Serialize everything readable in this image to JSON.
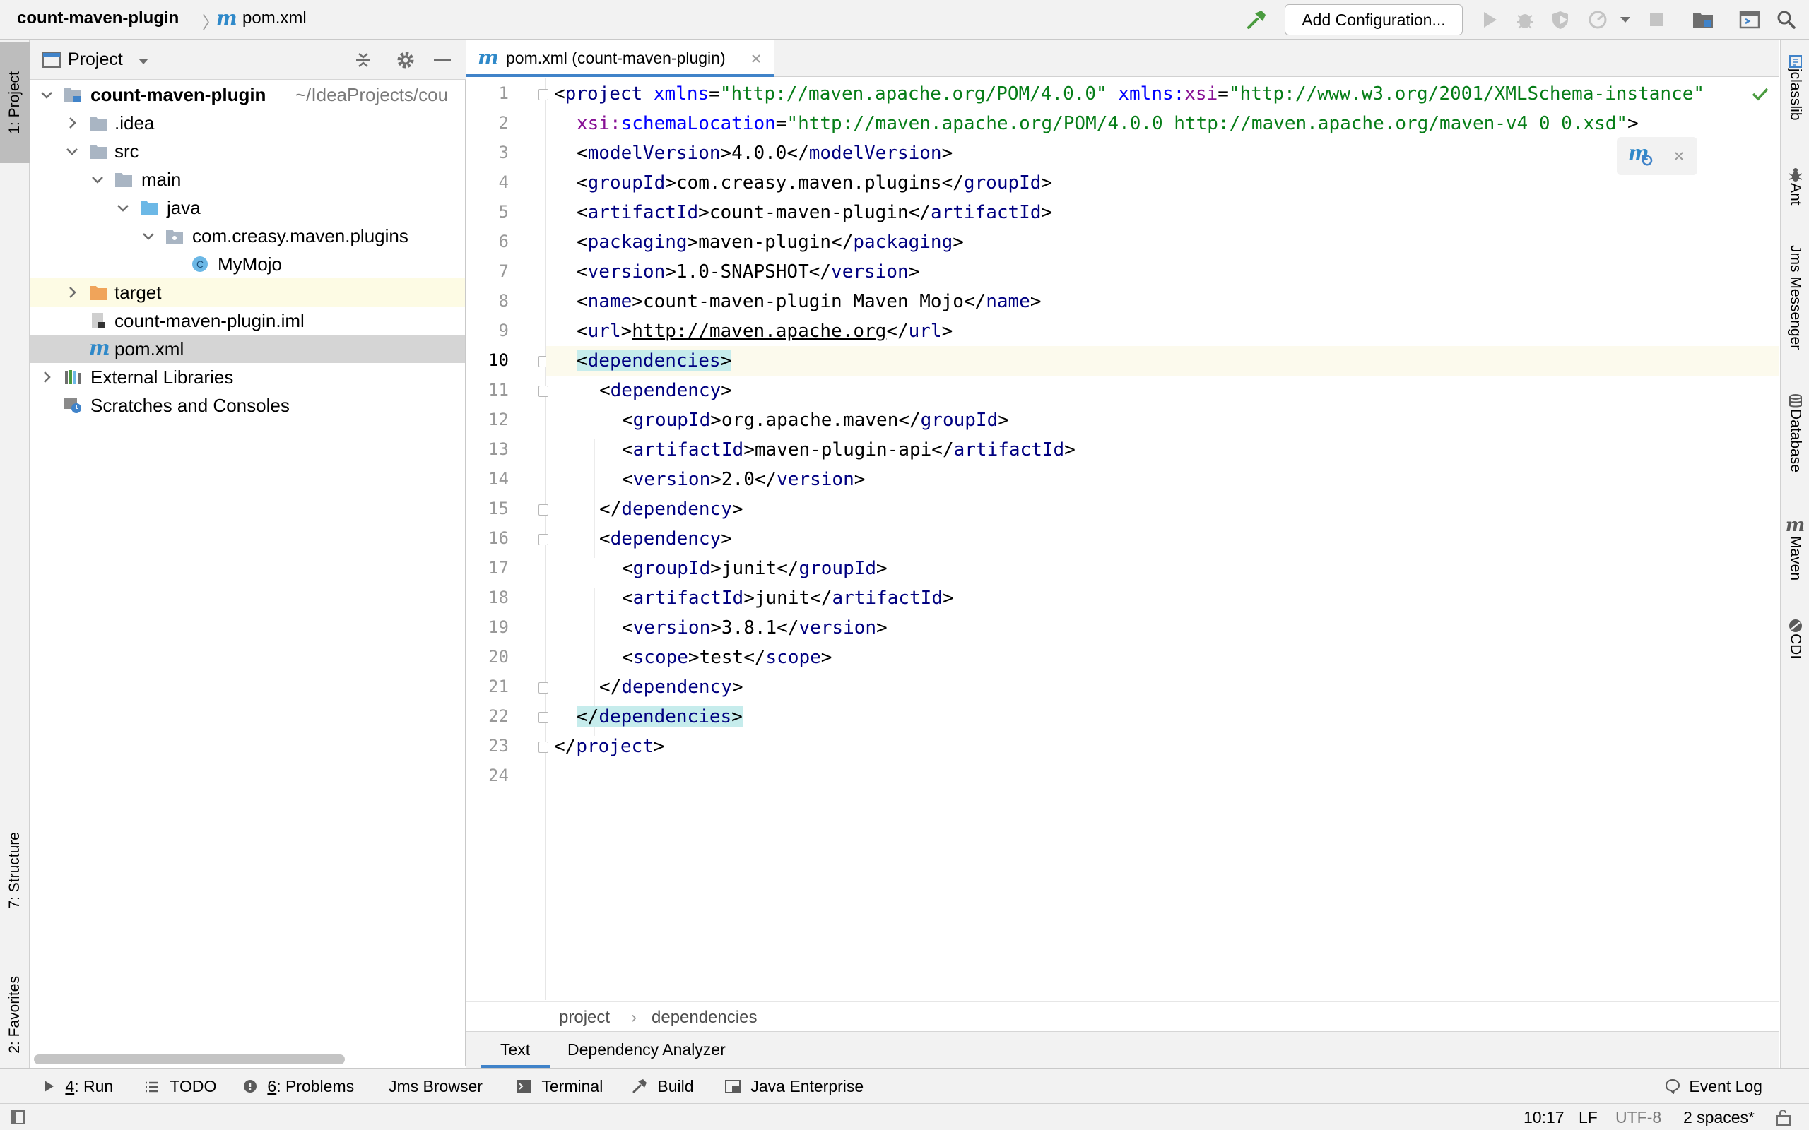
{
  "navbar": {
    "project_name": "count-maven-plugin",
    "file_icon_letter": "m",
    "file_name": "pom.xml",
    "add_configuration": "Add Configuration..."
  },
  "left_tools": {
    "project": "1: Project",
    "structure": "7: Structure",
    "favorites": "2: Favorites"
  },
  "project_panel": {
    "title": "Project",
    "tree": [
      {
        "label": "count-maven-plugin",
        "suffix": "~/IdeaProjects/cou",
        "icon": "module-folder-icon"
      },
      {
        "label": ".idea",
        "icon": "folder-icon"
      },
      {
        "label": "src",
        "icon": "folder-icon"
      },
      {
        "label": "main",
        "icon": "folder-icon"
      },
      {
        "label": "java",
        "icon": "source-folder-icon"
      },
      {
        "label": "com.creasy.maven.plugins",
        "icon": "package-icon"
      },
      {
        "label": "MyMojo",
        "icon": "class-icon",
        "icon_letter": "C"
      },
      {
        "label": "target",
        "icon": "excluded-folder-icon"
      },
      {
        "label": "count-maven-plugin.iml",
        "icon": "iml-file-icon"
      },
      {
        "label": "pom.xml",
        "icon": "maven-file-icon"
      },
      {
        "label": "External Libraries",
        "icon": "library-icon"
      },
      {
        "label": "Scratches and Consoles",
        "icon": "scratches-icon"
      }
    ]
  },
  "editor": {
    "tab_label": "pom.xml (count-maven-plugin)",
    "line_numbers": [
      "1",
      "2",
      "3",
      "4",
      "5",
      "6",
      "7",
      "8",
      "9",
      "10",
      "11",
      "12",
      "13",
      "14",
      "15",
      "16",
      "17",
      "18",
      "19",
      "20",
      "21",
      "22",
      "23",
      "24"
    ],
    "code": {
      "l1": {
        "tag_open": "<",
        "tag": "project",
        "attr1": "xmlns",
        "eq1": "=",
        "val1": "\"http://maven.apache.org/POM/4.0.0\"",
        "ns2": "xmlns:",
        "attr2": "xsi",
        "eq2": "=",
        "val2": "\"http://www.w3.org/2001/XMLSchema-instance\""
      },
      "l2": {
        "ns": "xsi:",
        "attr": "schemaLocation",
        "eq": "=",
        "val": "\"http://maven.apache.org/POM/4.0.0 http://maven.apache.org/maven-v4_0_0.xsd\"",
        "close": ">"
      },
      "l3": {
        "open": "<",
        "tag": "modelVersion",
        "mid": ">4.0.0</",
        "tag2": "modelVersion",
        "close": ">"
      },
      "l4": {
        "open": "<",
        "tag": "groupId",
        "mid": ">com.creasy.maven.plugins</",
        "tag2": "groupId",
        "close": ">"
      },
      "l5": {
        "open": "<",
        "tag": "artifactId",
        "mid": ">count-maven-plugin</",
        "tag2": "artifactId",
        "close": ">"
      },
      "l6": {
        "open": "<",
        "tag": "packaging",
        "mid": ">maven-plugin</",
        "tag2": "packaging",
        "close": ">"
      },
      "l7": {
        "open": "<",
        "tag": "version",
        "mid": ">1.0-SNAPSHOT</",
        "tag2": "version",
        "close": ">"
      },
      "l8": {
        "open": "<",
        "tag": "name",
        "mid": ">count-maven-plugin Maven Mojo</",
        "tag2": "name",
        "close": ">"
      },
      "l9": {
        "open": "<",
        "tag": "url",
        "mid_a": ">",
        "link": "http://maven.apache.org",
        "mid_b": "</",
        "tag2": "url",
        "close": ">"
      },
      "l10": {
        "open": "<",
        "tag": "dependencies",
        "close": ">"
      },
      "l11": {
        "open": "<",
        "tag": "dependency",
        "close": ">"
      },
      "l12": {
        "open": "<",
        "tag": "groupId",
        "mid": ">org.apache.maven</",
        "tag2": "groupId",
        "close": ">"
      },
      "l13": {
        "open": "<",
        "tag": "artifactId",
        "mid": ">maven-plugin-api</",
        "tag2": "artifactId",
        "close": ">"
      },
      "l14": {
        "open": "<",
        "tag": "version",
        "mid": ">2.0</",
        "tag2": "version",
        "close": ">"
      },
      "l15": {
        "open": "</",
        "tag": "dependency",
        "close": ">"
      },
      "l16": {
        "open": "<",
        "tag": "dependency",
        "close": ">"
      },
      "l17": {
        "open": "<",
        "tag": "groupId",
        "mid": ">junit</",
        "tag2": "groupId",
        "close": ">"
      },
      "l18": {
        "open": "<",
        "tag": "artifactId",
        "mid": ">junit</",
        "tag2": "artifactId",
        "close": ">"
      },
      "l19": {
        "open": "<",
        "tag": "version",
        "mid": ">3.8.1</",
        "tag2": "version",
        "close": ">"
      },
      "l20": {
        "open": "<",
        "tag": "scope",
        "mid": ">test</",
        "tag2": "scope",
        "close": ">"
      },
      "l21": {
        "open": "</",
        "tag": "dependency",
        "close": ">"
      },
      "l22": {
        "open": "</",
        "tag": "dependencies",
        "close": ">"
      },
      "l23": {
        "open": "</",
        "tag": "project",
        "close": ">"
      }
    },
    "breadcrumbs": [
      "project",
      "dependencies"
    ],
    "bottom_tabs": [
      "Text",
      "Dependency Analyzer"
    ]
  },
  "right_tools": {
    "jclasslib": "jclasslib",
    "ant": "Ant",
    "jms": "Jms Messenger",
    "database": "Database",
    "maven": "Maven",
    "cdi": "CDI"
  },
  "bottom_tools": {
    "run_num": "4",
    "run_label": ": Run",
    "todo": "TODO",
    "problems_num": "6",
    "problems_label": ": Problems",
    "jms_browser": "Jms Browser",
    "terminal": "Terminal",
    "build": "Build",
    "java_enterprise": "Java Enterprise",
    "event_log": "Event Log"
  },
  "status": {
    "position": "10:17",
    "line_sep": "LF",
    "encoding": "UTF-8",
    "indent": "2 spaces*"
  },
  "colors": {
    "accent": "#4083c9",
    "tag": "#000080",
    "attr": "#0000ff",
    "string": "#067d17",
    "namespace": "#871094",
    "caret_row": "#fcfaed",
    "brace_match": "#c6ecec"
  }
}
